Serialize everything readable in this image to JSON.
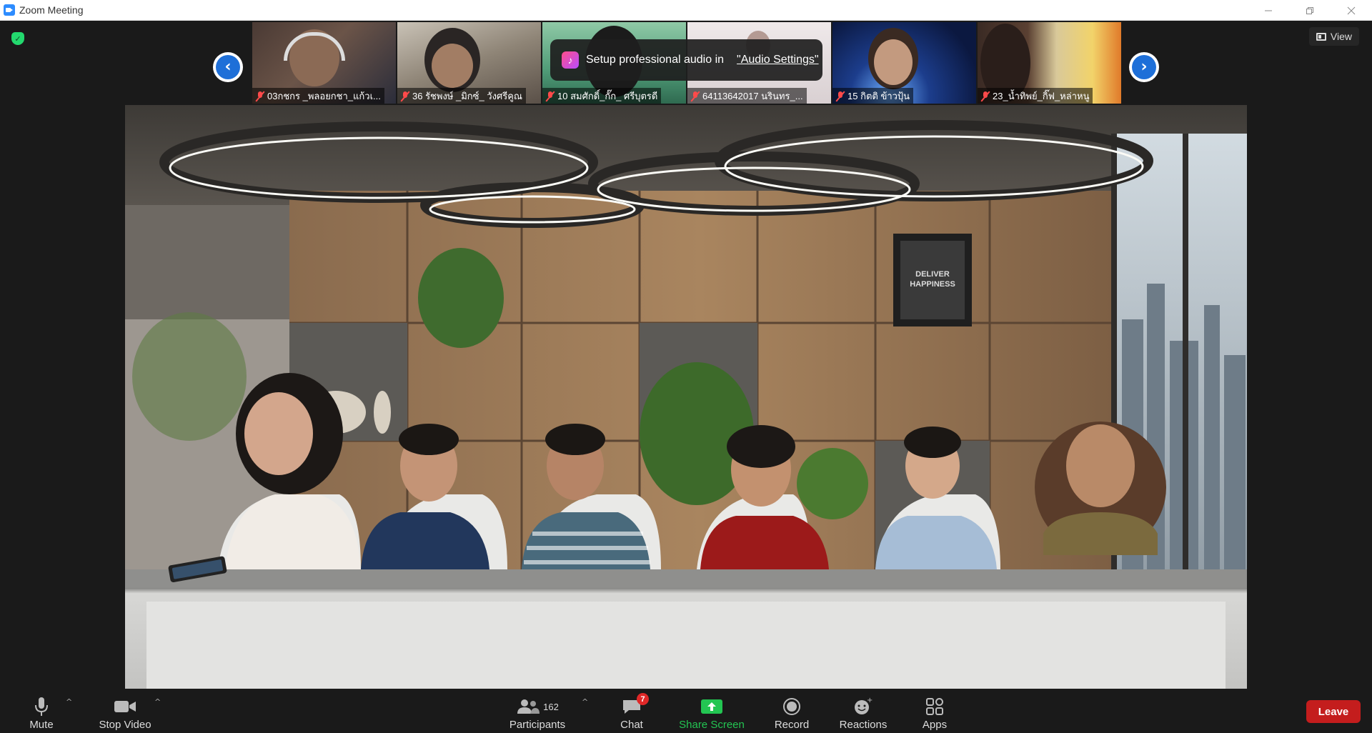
{
  "window": {
    "title": "Zoom Meeting",
    "controls": [
      "minimize",
      "restore",
      "close"
    ]
  },
  "header": {
    "view_label": "View",
    "security_status": "encrypted"
  },
  "gallery": {
    "tiles": [
      {
        "name": "03กชกร _พลอยกชา_แก้วเ...",
        "muted": true
      },
      {
        "name": "36 รัชพงษ์ _มิกซ์_ วังศรีคูณ",
        "muted": true
      },
      {
        "name": "10 สมศักดิ์_กั๊ก_ ศรีบุตรดี",
        "muted": true
      },
      {
        "name": "64113642017 นรินทร_...",
        "muted": true
      },
      {
        "name": "15 กิตติ ข้าวปุ้น",
        "muted": true
      },
      {
        "name": "23_น้ำทิพย์_กิ๊ฟ_หล่าหนู",
        "muted": true
      }
    ],
    "prev_label": "‹",
    "next_label": "›"
  },
  "notification": {
    "text": "Setup professional audio in",
    "link": "\"Audio Settings\""
  },
  "scene": {
    "poster_text": "DELIVER HAPPINESS"
  },
  "toolbar": {
    "mute_label": "Mute",
    "video_label": "Stop Video",
    "participants_label": "Participants",
    "participants_count": "162",
    "chat_label": "Chat",
    "chat_badge": "7",
    "share_label": "Share Screen",
    "record_label": "Record",
    "reactions_label": "Reactions",
    "apps_label": "Apps",
    "leave_label": "Leave"
  },
  "colors": {
    "accent_blue": "#1e6fd8",
    "share_green": "#23c552",
    "leave_red": "#c41d1d",
    "muted_red": "#ff4a4a",
    "badge_red": "#e02828"
  }
}
